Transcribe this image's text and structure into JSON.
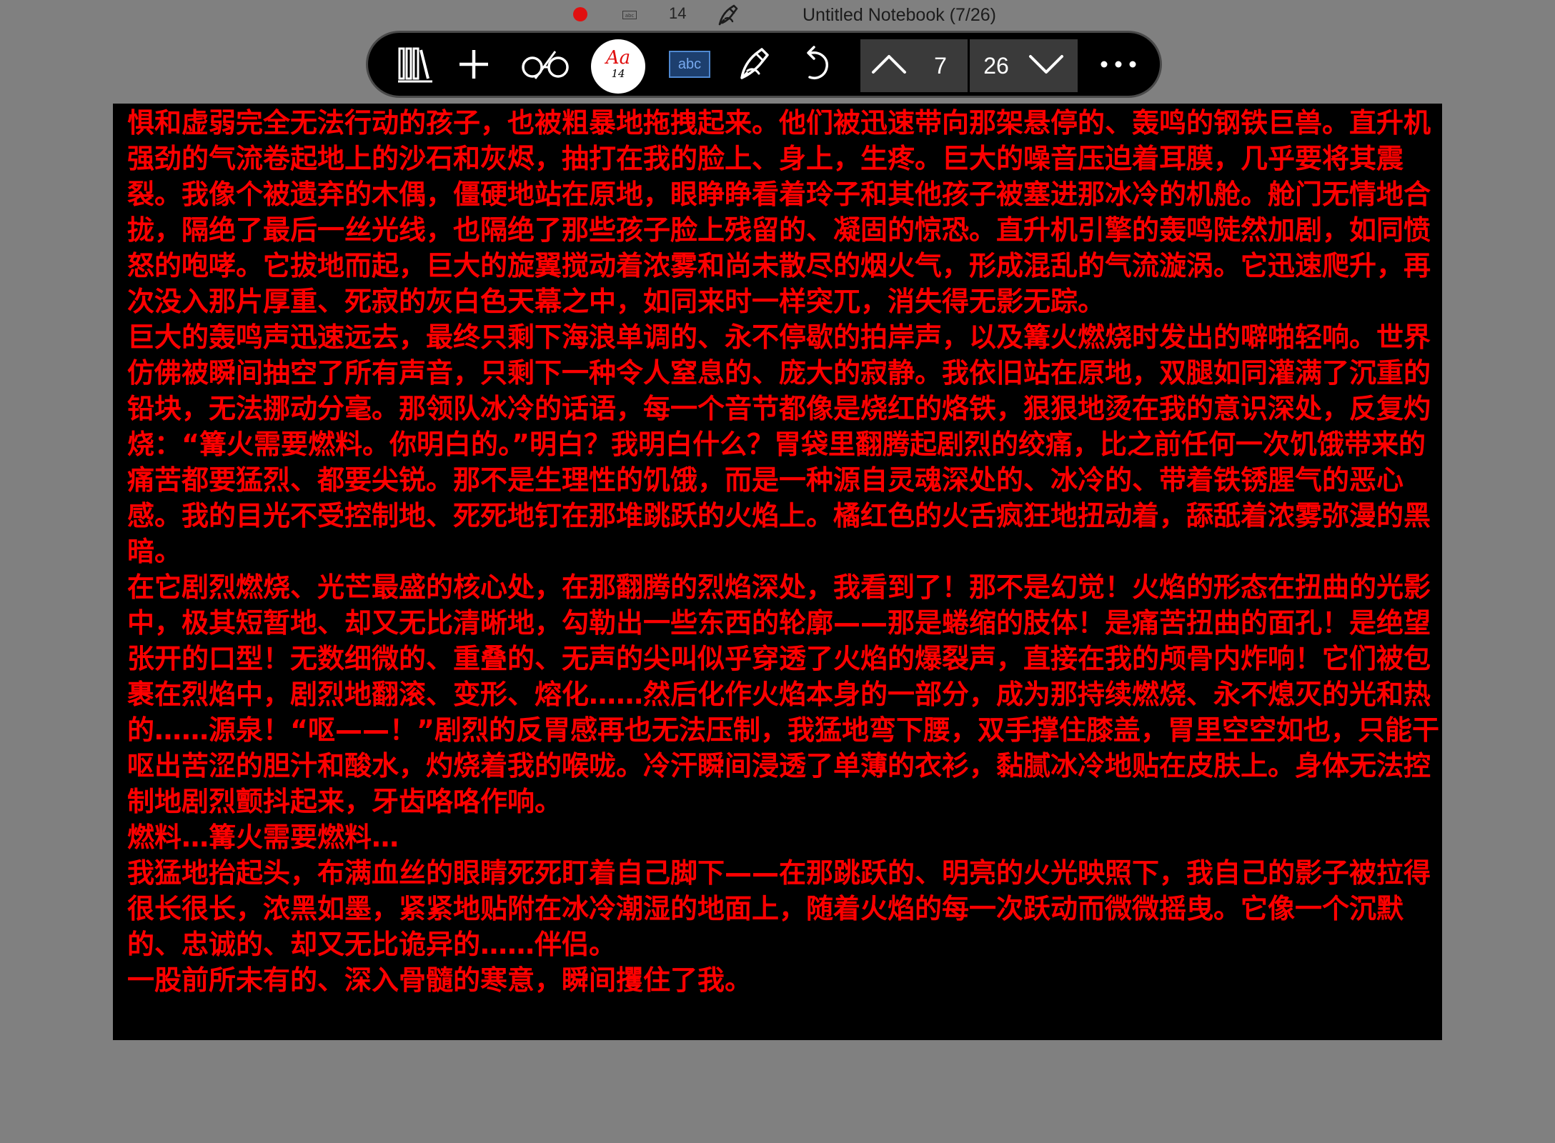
{
  "status": {
    "recording_color": "#e01010",
    "mini_abc": "abc",
    "font_size": "14",
    "title": "Untitled Notebook (7/26)"
  },
  "toolbar": {
    "font_button": {
      "glyph": "Aa",
      "size": "14"
    },
    "abc_label": "abc",
    "pager": {
      "current": "7",
      "total": "26"
    },
    "icons": [
      "library-icon",
      "plus-icon",
      "glasses-icon",
      "font-icon",
      "abc-icon",
      "pen-icon",
      "undo-icon",
      "chevron-up-icon",
      "chevron-down-icon",
      "more-icon"
    ]
  },
  "document": {
    "text_color": "#ff0000",
    "background": "#000000",
    "paragraphs": [
      "惧和虚弱完全无法行动的孩子，也被粗暴地拖拽起来。他们被迅速带向那架悬停的、轰鸣的钢铁巨兽。直升机强劲的气流卷起地上的沙石和灰烬，抽打在我的脸上、身上，生疼。巨大的噪音压迫着耳膜，几乎要将其震裂。我像个被遗弃的木偶，僵硬地站在原地，眼睁睁看着玲子和其他孩子被塞进那冰冷的机舱。舱门无情地合拢，隔绝了最后一丝光线，也隔绝了那些孩子脸上残留的、凝固的惊恐。直升机引擎的轰鸣陡然加剧，如同愤怒的咆哮。它拔地而起，巨大的旋翼搅动着浓雾和尚未散尽的烟火气，形成混乱的气流漩涡。它迅速爬升，再次没入那片厚重、死寂的灰白色天幕之中，如同来时一样突兀，消失得无影无踪。",
      "巨大的轰鸣声迅速远去，最终只剩下海浪单调的、永不停歇的拍岸声，以及篝火燃烧时发出的噼啪轻响。世界仿佛被瞬间抽空了所有声音，只剩下一种令人窒息的、庞大的寂静。我依旧站在原地，双腿如同灌满了沉重的铅块，无法挪动分毫。那领队冰冷的话语，每一个音节都像是烧红的烙铁，狠狠地烫在我的意识深处，反复灼烧：“篝火需要燃料。你明白的。”明白？我明白什么？胃袋里翻腾起剧烈的绞痛，比之前任何一次饥饿带来的痛苦都要猛烈、都要尖锐。那不是生理性的饥饿，而是一种源自灵魂深处的、冰冷的、带着铁锈腥气的恶心感。我的目光不受控制地、死死地钉在那堆跳跃的火焰上。橘红色的火舌疯狂地扭动着，舔舐着浓雾弥漫的黑暗。",
      "在它剧烈燃烧、光芒最盛的核心处，在那翻腾的烈焰深处，我看到了！那不是幻觉！火焰的形态在扭曲的光影中，极其短暂地、却又无比清晰地，勾勒出一些东西的轮廓——那是蜷缩的肢体！是痛苦扭曲的面孔！是绝望张开的口型！无数细微的、重叠的、无声的尖叫似乎穿透了火焰的爆裂声，直接在我的颅骨内炸响！它们被包裹在烈焰中，剧烈地翻滚、变形、熔化……然后化作火焰本身的一部分，成为那持续燃烧、永不熄灭的光和热的……源泉！“呕——！”剧烈的反胃感再也无法压制，我猛地弯下腰，双手撑住膝盖，胃里空空如也，只能干呕出苦涩的胆汁和酸水，灼烧着我的喉咙。冷汗瞬间浸透了单薄的衣衫，黏腻冰冷地贴在皮肤上。身体无法控制地剧烈颤抖起来，牙齿咯咯作响。",
      "燃料…篝火需要燃料…",
      "我猛地抬起头，布满血丝的眼睛死死盯着自己脚下——在那跳跃的、明亮的火光映照下，我自己的影子被拉得很长很长，浓黑如墨，紧紧地贴附在冰冷潮湿的地面上，随着火焰的每一次跃动而微微摇曳。它像一个沉默的、忠诚的、却又无比诡异的……伴侣。",
      "一股前所未有的、深入骨髓的寒意，瞬间攫住了我。"
    ]
  }
}
